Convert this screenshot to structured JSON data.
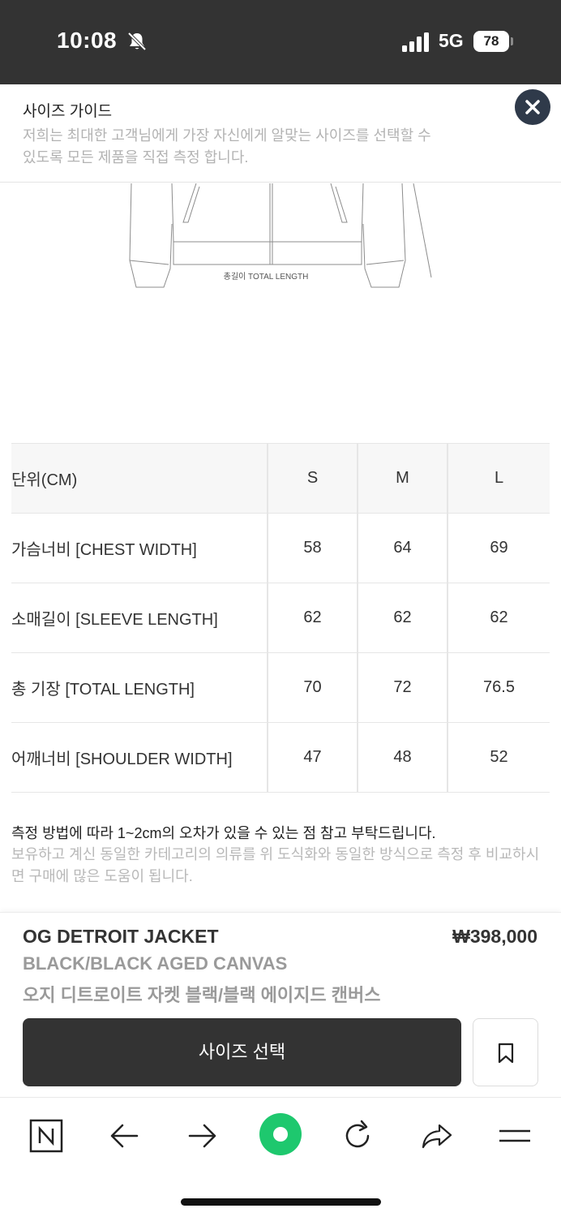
{
  "status_bar": {
    "time": "10:08",
    "network": "5G",
    "battery": "78"
  },
  "size_guide": {
    "title": "사이즈 가이드",
    "description": "저희는 최대한 고객님에게 가장 자신에게 알맞는 사이즈를 선택할 수 있도록 모든 제품을 직접 측정 합니다.",
    "drawing_caption": "총길이 TOTAL LENGTH",
    "table": {
      "unit_header": "단위(CM)",
      "sizes": [
        "S",
        "M",
        "L"
      ],
      "rows": [
        {
          "label": "가슴너비 [CHEST WIDTH]",
          "values": [
            "58",
            "64",
            "69"
          ]
        },
        {
          "label": "소매길이 [SLEEVE LENGTH]",
          "values": [
            "62",
            "62",
            "62"
          ]
        },
        {
          "label": "총 기장 [TOTAL LENGTH]",
          "values": [
            "70",
            "72",
            "76.5"
          ]
        },
        {
          "label": "어깨너비 [SHOULDER WIDTH]",
          "values": [
            "47",
            "48",
            "52"
          ]
        }
      ]
    },
    "note_main": "측정 방법에 따라 1~2cm의 오차가 있을 수 있는 점 참고 부탁드립니다.",
    "note_sub": "보유하고 계신 동일한 카테고리의 의류를 위 도식화와 동일한 방식으로 측정 후 비교하시면 구매에 많은 도움이 됩니다."
  },
  "product": {
    "name": "OG DETROIT JACKET",
    "price": "₩398,000",
    "color": "BLACK/BLACK AGED CANVAS",
    "korean_name": "오지 디트로이트 자켓 블랙/블랙 에이지드 캔버스",
    "size_select_label": "사이즈 선택"
  },
  "browser_toolbar": {
    "items": [
      "naver-home-icon",
      "back-arrow-icon",
      "forward-arrow-icon",
      "green-dot-icon",
      "refresh-icon",
      "share-icon",
      "menu-icon"
    ]
  },
  "colors": {
    "status_bar": "#333333",
    "close_button": "#2f3a4a",
    "primary_button": "#333333",
    "accent_green": "#1ec800"
  }
}
